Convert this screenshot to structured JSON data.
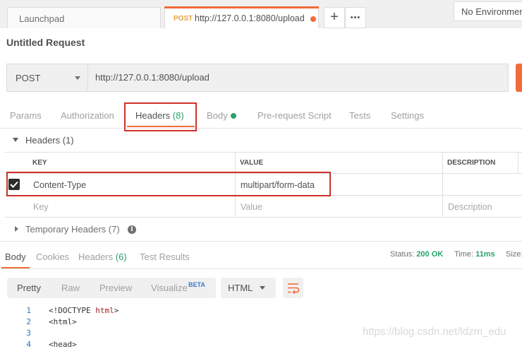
{
  "tabs": {
    "launchpad": "Launchpad",
    "active_method": "POST",
    "active_url": "http://127.0.0.1:8080/upload",
    "add_label": "+",
    "more_label": "•••"
  },
  "environment": {
    "label": "No Environment"
  },
  "request": {
    "title": "Untitled Request",
    "method": "POST",
    "url": "http://127.0.0.1:8080/upload"
  },
  "request_tabs": {
    "params": "Params",
    "authorization": "Authorization",
    "headers": "Headers",
    "headers_count": "(8)",
    "body": "Body",
    "prerequest": "Pre-request Script",
    "tests": "Tests",
    "settings": "Settings"
  },
  "headers_section": {
    "title": "Headers (1)",
    "columns": {
      "key": "KEY",
      "value": "VALUE",
      "description": "DESCRIPTION"
    },
    "rows": [
      {
        "key": "Content-Type",
        "value": "multipart/form-data",
        "checked": true
      }
    ],
    "placeholders": {
      "key": "Key",
      "value": "Value",
      "description": "Description"
    }
  },
  "temporary_headers": {
    "title": "Temporary Headers (7)",
    "info_glyph": "i"
  },
  "response_tabs": {
    "body": "Body",
    "cookies": "Cookies",
    "headers": "Headers",
    "headers_count": "(6)",
    "test_results": "Test Results"
  },
  "status": {
    "status_label": "Status:",
    "status_value": "200 OK",
    "time_label": "Time:",
    "time_value": "11ms",
    "size_label": "Size:"
  },
  "response_toolbar": {
    "pretty": "Pretty",
    "raw": "Raw",
    "preview": "Preview",
    "visualize": "Visualize",
    "beta": "BETA",
    "language": "HTML"
  },
  "code_lines": [
    {
      "num": "1",
      "pre": "<!DOCTYPE ",
      "kw": "html",
      "post": ">"
    },
    {
      "num": "2",
      "pre": "<html>",
      "kw": "",
      "post": ""
    },
    {
      "num": "3",
      "pre": "",
      "kw": "",
      "post": ""
    },
    {
      "num": "4",
      "pre": "<head>",
      "kw": "",
      "post": ""
    }
  ],
  "watermark": "https://blog.csdn.net/ldzm_edu",
  "colors": {
    "accent": "#f26b3a",
    "success": "#29a36a",
    "highlight": "#d0302a",
    "beta": "#3a7bd5"
  }
}
